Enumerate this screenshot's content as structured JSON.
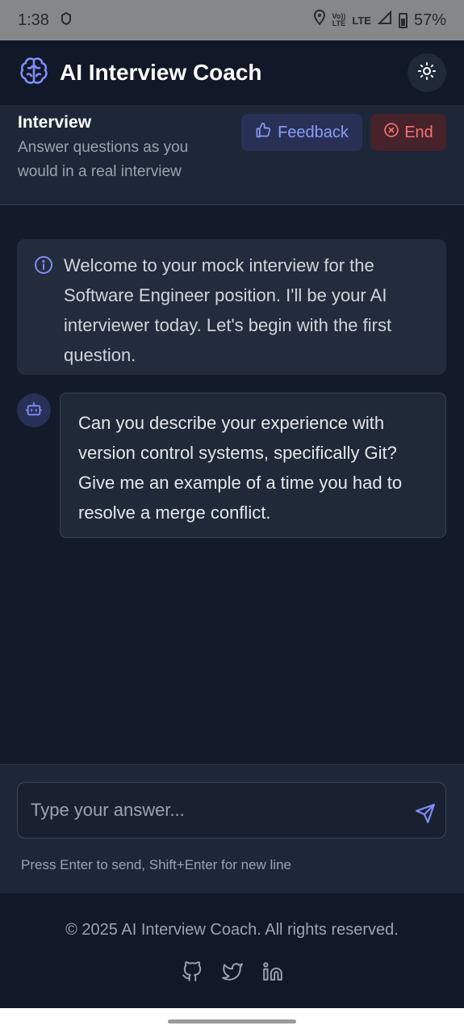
{
  "status_bar": {
    "time": "1:38",
    "net_top": "Vo))",
    "net_bottom": "LTE",
    "lte": "LTE",
    "battery": "57%"
  },
  "header": {
    "title": "AI Interview Coach",
    "logo_icon": "brain-icon",
    "theme_icon": "sun-icon"
  },
  "interview": {
    "title": "Interview",
    "description": "Answer questions as you would in a real interview",
    "feedback_label": "Feedback",
    "end_label": "End"
  },
  "chat": {
    "welcome": "Welcome to your mock interview for the Software Engineer position. I'll be your AI interviewer today. Let's begin with the first question.",
    "question": "Can you describe your experience with version control systems, specifically Git? Give me an example of a time you had to resolve a merge conflict."
  },
  "input": {
    "placeholder": "Type your answer...",
    "hint": "Press Enter to send, Shift+Enter for new line"
  },
  "footer": {
    "copyright": "© 2025 AI Interview Coach. All rights reserved.",
    "socials": [
      "github-icon",
      "twitter-icon",
      "linkedin-icon"
    ]
  },
  "colors": {
    "accent": "#818cf8",
    "danger": "#f87171",
    "background": "#131a2a"
  }
}
